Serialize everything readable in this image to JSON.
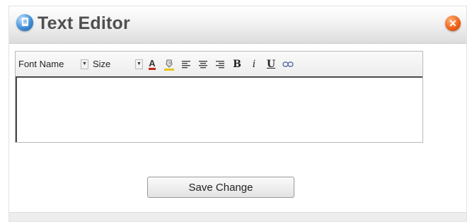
{
  "dialog": {
    "title": "Text Editor",
    "title_icon": "document-icon",
    "close_icon": "close-icon",
    "close_glyph": "✕"
  },
  "toolbar": {
    "font_name": "Font Name",
    "size": "Size",
    "dropdown_glyph": "▼",
    "text_color_glyph": "A",
    "text_color_icon": "text-color-icon",
    "highlight_icon": "highlight-color-icon",
    "align_left_icon": "align-left-icon",
    "align_center_icon": "align-center-icon",
    "align_right_icon": "align-right-icon",
    "bold_glyph": "B",
    "italic_glyph": "i",
    "underline_glyph": "U",
    "link_icon": "link-icon",
    "accent_color": "#c0261a"
  },
  "editor": {
    "content": ""
  },
  "actions": {
    "save_label": "Save Change"
  }
}
